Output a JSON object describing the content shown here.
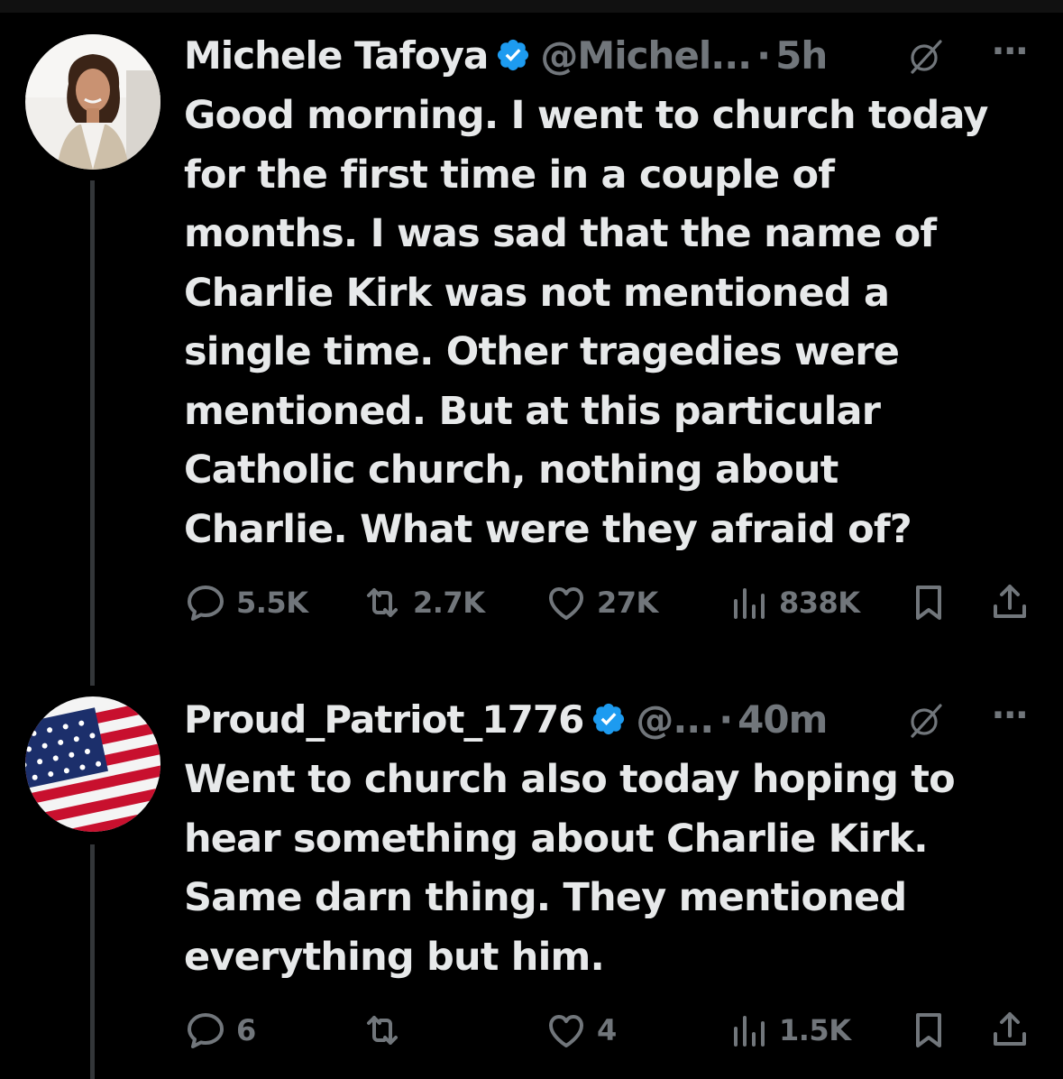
{
  "tweets": [
    {
      "name": "Michele Tafoya",
      "handle": "@Michel...",
      "dot": "·",
      "time": "5h",
      "more": "···",
      "text": "Good morning.  I went to church today\nfor the first time in a couple of\nmonths.  I was sad that the name of\nCharlie Kirk was not mentioned a\nsingle time.  Other tragedies were\nmentioned. But at this particular\nCatholic church, nothing about\nCharlie.  What were they afraid of?",
      "replies": "5.5K",
      "reposts": "2.7K",
      "likes": "27K",
      "views": "838K"
    },
    {
      "name": "Proud_Patriot_1776",
      "handle": "@...",
      "dot": "·",
      "time": "40m",
      "more": "···",
      "text": "Went to church also today hoping to\nhear something about Charlie Kirk.\nSame darn thing. They mentioned\neverything but him.",
      "replies": "6",
      "reposts": "",
      "likes": "4",
      "views": "1.5K"
    }
  ],
  "colors": {
    "background": "#000000",
    "text": "#e7e9ea",
    "muted": "#71767b",
    "verified": "#1d9bf0",
    "thread_line": "#333639"
  },
  "icons": [
    "verified-badge-icon",
    "grok-icon",
    "more-icon",
    "reply-icon",
    "repost-icon",
    "like-icon",
    "views-icon",
    "bookmark-icon",
    "share-icon"
  ]
}
